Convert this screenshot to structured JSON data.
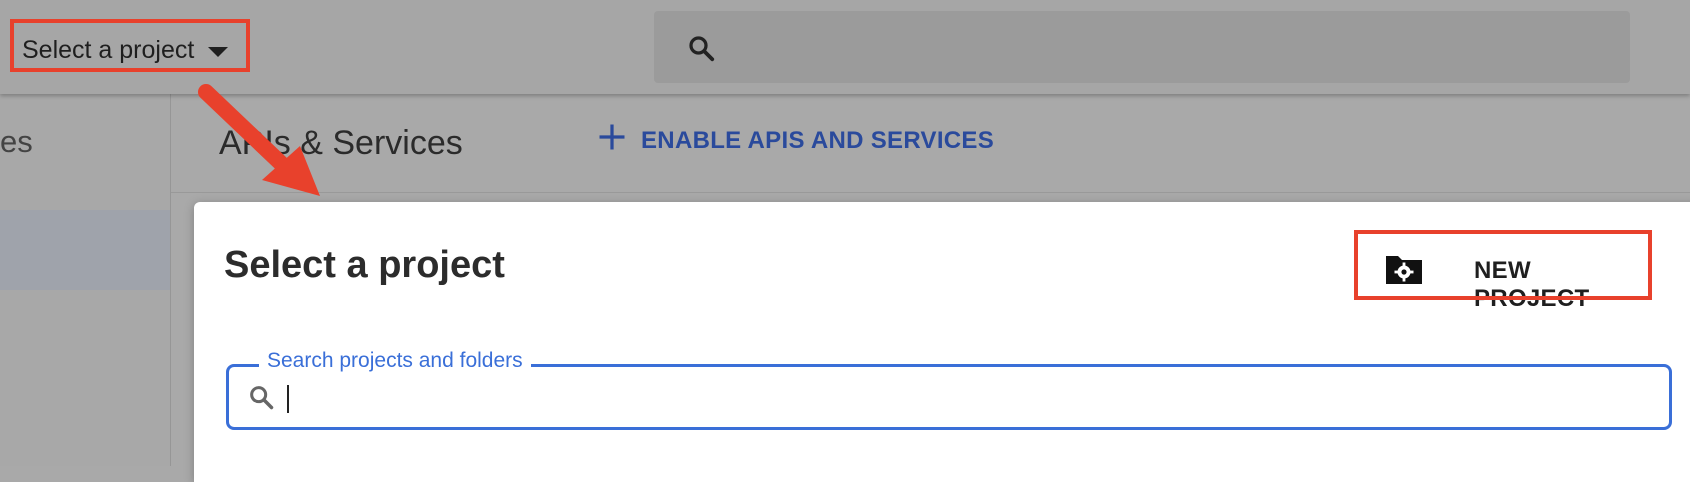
{
  "topbar": {
    "project_picker_label": "Select a project",
    "search_placeholder": ""
  },
  "leftnav": {
    "partial_title": "es"
  },
  "page_header": {
    "title": "APIs & Services",
    "enable_apis_label": "ENABLE APIS AND SERVICES"
  },
  "dialog": {
    "title": "Select a project",
    "new_project_label": "NEW PROJECT",
    "search_label": "Search projects and folders",
    "search_value": ""
  },
  "icons": {
    "topbar_search": "search-icon",
    "dropdown": "caret-down-icon",
    "enable_apis": "plus-icon",
    "new_project": "folder-gear-icon",
    "dialog_search": "search-icon"
  },
  "colors": {
    "annotation": "#e8412c",
    "accent_blue": "#3a6fd8",
    "link_blue": "#2a4a9c"
  }
}
